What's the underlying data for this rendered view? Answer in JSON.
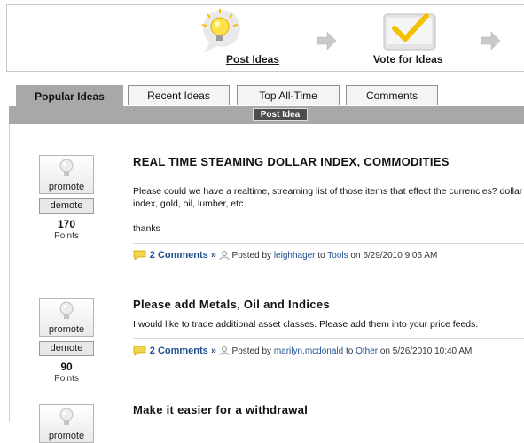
{
  "banner": {
    "step1_label": "Post Ideas",
    "step2_label": "Vote for Ideas"
  },
  "tabs": [
    {
      "label": "Popular Ideas",
      "active": true
    },
    {
      "label": "Recent Ideas",
      "active": false
    },
    {
      "label": "Top All-Time",
      "active": false
    },
    {
      "label": "Comments",
      "active": false
    }
  ],
  "post_idea_button": "Post Idea",
  "ideas": [
    {
      "title": "REAL TIME STEAMING DOLLAR INDEX, COMMODITIES",
      "body": [
        "Please could we have a realtime, streaming list of those items that effect the currencies? dollar index, gold, oil, lumber, etc.",
        "thanks"
      ],
      "score": "170",
      "points_label": "Points",
      "promote_label": "promote",
      "demote_label": "demote",
      "comments": "2 Comments »",
      "posted_by_prefix": "Posted by",
      "author": "leighhager",
      "to_word": "to",
      "category": "Tools",
      "on_word": "on",
      "date": "6/29/2010 9:06 AM"
    },
    {
      "title": "Please add Metals, Oil and Indices",
      "body": [
        "I would like to trade additional asset classes.  Please add them into your price feeds."
      ],
      "score": "90",
      "points_label": "Points",
      "promote_label": "promote",
      "demote_label": "demote",
      "comments": "2 Comments »",
      "posted_by_prefix": "Posted by",
      "author": "marilyn.mcdonald",
      "to_word": "to",
      "category": "Other",
      "on_word": "on",
      "date": "5/26/2010 10:40 AM"
    },
    {
      "title": "Make it easier for a withdrawal",
      "promote_label": "promote"
    }
  ]
}
